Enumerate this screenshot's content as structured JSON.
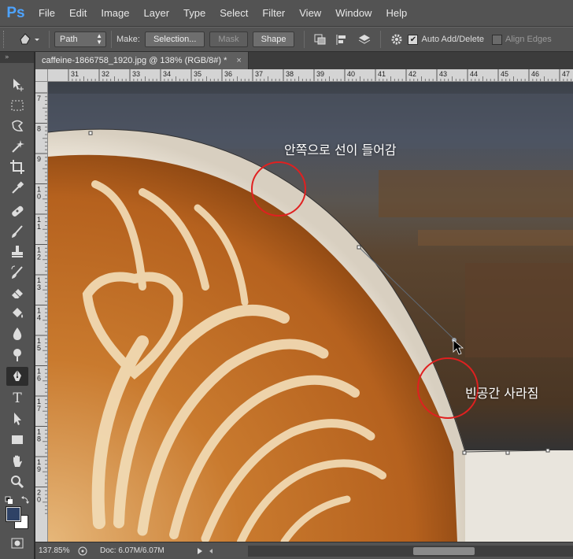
{
  "app": {
    "logo": "Ps"
  },
  "menu": [
    "File",
    "Edit",
    "Image",
    "Layer",
    "Type",
    "Select",
    "Filter",
    "View",
    "Window",
    "Help"
  ],
  "options": {
    "tool_mode": "Path",
    "make_label": "Make:",
    "selection_btn": "Selection...",
    "mask_btn": "Mask",
    "shape_btn": "Shape",
    "auto_add_delete": "Auto Add/Delete",
    "auto_add_delete_checked": true,
    "align_edges": "Align Edges",
    "align_edges_checked": false
  },
  "document": {
    "tab_title": "caffeine-1866758_1920.jpg @ 138% (RGB/8#) *",
    "close": "×"
  },
  "ruler": {
    "h_ticks": [
      "31",
      "32",
      "33",
      "34",
      "35",
      "36",
      "37",
      "38",
      "39",
      "40",
      "41",
      "42",
      "43",
      "44",
      "45",
      "46",
      "47"
    ],
    "v_ticks": [
      "7",
      "8",
      "9",
      "1 0",
      "1 1",
      "1 2",
      "1 3",
      "1 4",
      "1 5",
      "1 6",
      "1 7",
      "1 8",
      "1 9",
      "2 0"
    ]
  },
  "annotations": {
    "inner_line": "안쪽으로 선이 들어감",
    "gap_disappear": "빈공간 사라짐"
  },
  "status": {
    "zoom": "137.85%",
    "doc": "Doc: 6.07M/6.07M"
  },
  "colors": {
    "ui_bg": "#535353",
    "annotation_circle": "#e02020",
    "foreground_swatch": "#2f4266",
    "background_swatch": "#ffffff"
  }
}
